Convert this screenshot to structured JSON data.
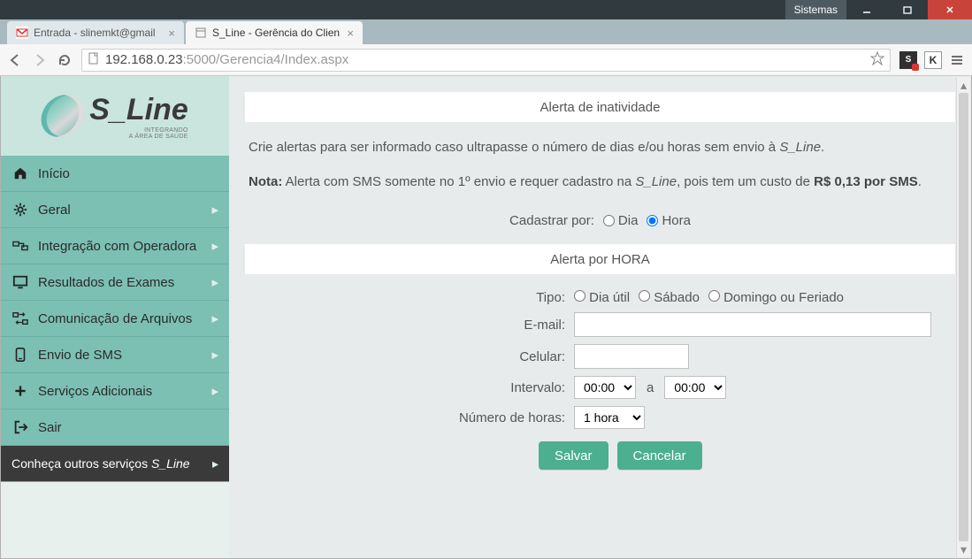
{
  "window": {
    "sistemas_label": "Sistemas"
  },
  "tabs": [
    {
      "title": "Entrada - slinemkt@gmail"
    },
    {
      "title": "S_Line - Gerência do Clien"
    }
  ],
  "addressbar": {
    "host": "192.168.0.23",
    "rest": ":5000/Gerencia4/Index.aspx"
  },
  "logo": {
    "name": "S_Line",
    "tagline1": "INTEGRANDO",
    "tagline2": "A ÁREA DE SAÚDE"
  },
  "sidebar": {
    "items": [
      {
        "label": "Início",
        "icon": "home",
        "expandable": false
      },
      {
        "label": "Geral",
        "icon": "gear",
        "expandable": true
      },
      {
        "label": "Integração com Operadora",
        "icon": "link",
        "expandable": true
      },
      {
        "label": "Resultados de Exames",
        "icon": "monitor",
        "expandable": true
      },
      {
        "label": "Comunicação de Arquivos",
        "icon": "transfer",
        "expandable": true
      },
      {
        "label": "Envio de SMS",
        "icon": "sms",
        "expandable": true
      },
      {
        "label": "Serviços Adicionais",
        "icon": "plus",
        "expandable": true
      },
      {
        "label": "Sair",
        "icon": "exit",
        "expandable": false
      }
    ],
    "promo_prefix": "Conheça outros serviços ",
    "promo_brand": "S_Line"
  },
  "main": {
    "header1": "Alerta de inatividade",
    "desc_line1_a": "Crie alertas para ser informado caso ultrapasse o número de dias e/ou horas sem envio à ",
    "desc_brand": "S_Line",
    "desc_period": ".",
    "nota_label": "Nota:",
    "nota_text_a": " Alerta com SMS somente no 1º envio e requer cadastro na ",
    "nota_text_b": ", pois tem um custo de ",
    "nota_price": "R$ 0,13 por SMS",
    "cadastrar_label": "Cadastrar por:",
    "radio_dia": "Dia",
    "radio_hora": "Hora",
    "header2": "Alerta por HORA",
    "tipo_label": "Tipo:",
    "tipo_opts": {
      "util": "Dia útil",
      "sabado": "Sábado",
      "domingo": "Domingo ou Feriado"
    },
    "email_label": "E-mail:",
    "email_value": "",
    "celular_label": "Celular:",
    "celular_value": "",
    "intervalo_label": "Intervalo:",
    "intervalo_from": "00:00",
    "intervalo_sep": "a",
    "intervalo_to": "00:00",
    "numhoras_label": "Número de horas:",
    "numhoras_value": "1 hora",
    "btn_salvar": "Salvar",
    "btn_cancelar": "Cancelar"
  }
}
